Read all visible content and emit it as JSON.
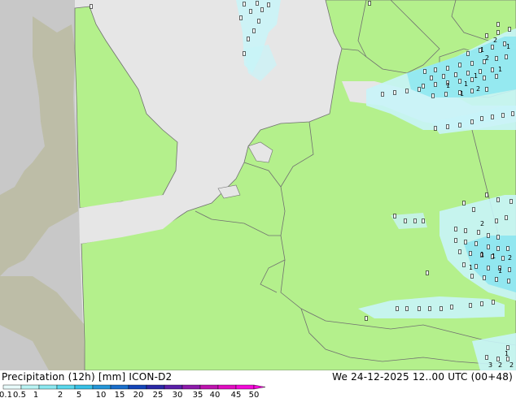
{
  "footer": {
    "title": "Precipitation (12h) [mm] ICON-D2",
    "valid_time": "We 24-12-2025 12..00 UTC (00+48)"
  },
  "legend": {
    "ticks": [
      "0.1",
      "0.5",
      "1",
      "2",
      "5",
      "10",
      "15",
      "20",
      "25",
      "30",
      "35",
      "40",
      "45",
      "50"
    ],
    "colors": [
      "#e8fbfb",
      "#b9f3f3",
      "#8ce8f0",
      "#5bd8ec",
      "#38c0e6",
      "#2596d8",
      "#1a6fcb",
      "#1445b8",
      "#2a28a6",
      "#5a1fa8",
      "#8c1aaa",
      "#bd14ae",
      "#e00ec0",
      "#f20ad8"
    ]
  },
  "colors": {
    "land": "#b4f08c",
    "sea": "#e6e6e6",
    "outside_domain": "#c8c8c8",
    "precip_light": "#c8f4f8",
    "precip_medium": "#8ce6f0",
    "border": "#707070"
  },
  "grid_labels": [
    {
      "text": "1"
    },
    {
      "text": "2"
    },
    {
      "text": "1"
    },
    {
      "text": "1"
    },
    {
      "text": "2"
    },
    {
      "text": "1"
    },
    {
      "text": "2"
    },
    {
      "text": "1"
    },
    {
      "text": "1"
    },
    {
      "text": "1"
    },
    {
      "text": "2"
    },
    {
      "text": "1"
    },
    {
      "text": "1"
    },
    {
      "text": "1"
    },
    {
      "text": "1"
    },
    {
      "text": "2"
    },
    {
      "text": "3"
    },
    {
      "text": "2"
    },
    {
      "text": "2"
    },
    {
      "text": "1"
    }
  ]
}
